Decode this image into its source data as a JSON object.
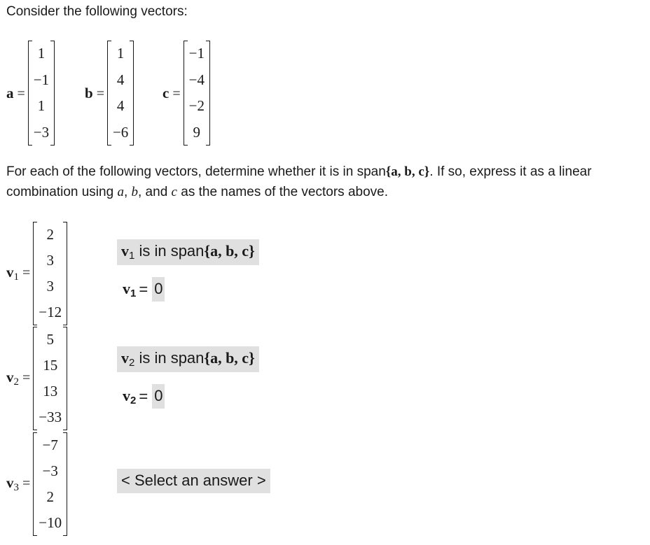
{
  "intro_text": "Consider the following vectors:",
  "given_vectors": [
    {
      "name": "a",
      "entries": [
        "1",
        "−1",
        "1",
        "−3"
      ]
    },
    {
      "name": "b",
      "entries": [
        "1",
        "4",
        "4",
        "−6"
      ]
    },
    {
      "name": "c",
      "entries": [
        "−1",
        "−4",
        "−2",
        "9"
      ]
    }
  ],
  "equals": "=",
  "instructions": {
    "part1": "For each of the following vectors, determine whether it is in span",
    "span_set": "{a, b, c}",
    "part2": ". If so, express it as a linear combination using ",
    "var_a": "a",
    "comma1": ", ",
    "var_b": "b",
    "comma2": ", and ",
    "var_c": "c",
    "part3": " as the names of the vectors above."
  },
  "questions": [
    {
      "vector_name": "v",
      "subscript": "1",
      "entries": [
        "2",
        "3",
        "3",
        "−12"
      ],
      "dropdown": {
        "prefix": " is in span",
        "set": "{a, b, c}"
      },
      "answer_value": "0"
    },
    {
      "vector_name": "v",
      "subscript": "2",
      "entries": [
        "5",
        "15",
        "13",
        "−33"
      ],
      "dropdown": {
        "prefix": " is in span",
        "set": "{a, b, c}"
      },
      "answer_value": "0"
    },
    {
      "vector_name": "v",
      "subscript": "3",
      "entries": [
        "−7",
        "−3",
        "2",
        "−10"
      ],
      "dropdown": {
        "placeholder": "< Select an answer >"
      }
    }
  ],
  "colors": {
    "answer_background": "#e0e0e0",
    "text": "#1a1a1a"
  }
}
